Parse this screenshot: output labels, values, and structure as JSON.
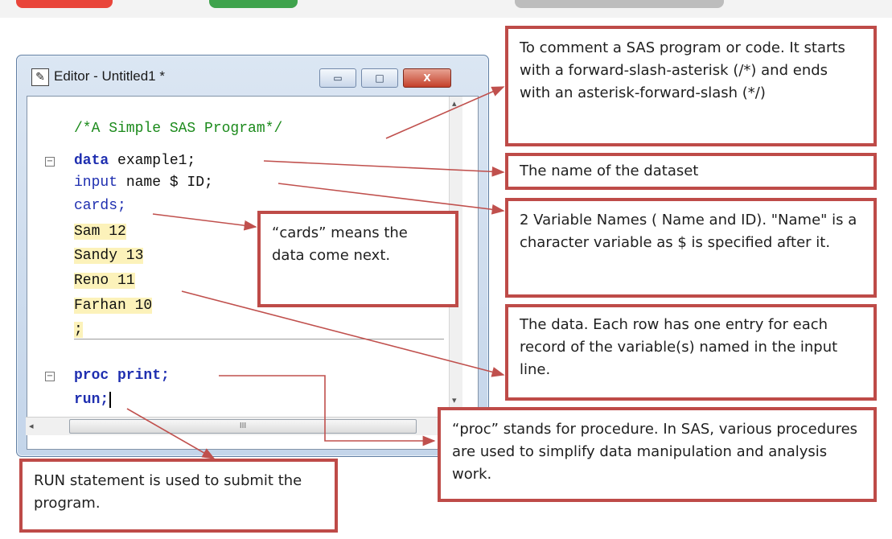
{
  "window": {
    "title": "Editor - Untitled1 *",
    "controls": {
      "minimize": "▭",
      "maximize": "□",
      "close": "X"
    },
    "hscroll_thumb": "III"
  },
  "code": {
    "comment": "/*A Simple SAS Program*/",
    "data_kw": "data",
    "data_rest": " example1;",
    "input_kw": "input",
    "input_rest": " name $ ID;",
    "cards_kw": "cards;",
    "rows": [
      "Sam 12",
      "Sandy 13",
      "Reno 11",
      "Farhan 10"
    ],
    "semicolon": ";",
    "proc_kw": "proc print;",
    "run_kw": "run;"
  },
  "notes": {
    "comment": "To comment a SAS program or code. It starts with a forward-slash-asterisk (/*) and ends with an asterisk-forward-slash (*/)",
    "dataset": "The name of the dataset",
    "variables": "2 Variable Names ( Name and ID). \"Name\" is a character variable as $ is specified after it.",
    "cards": "“cards” means the data come next.",
    "data": "The data. Each row has one entry for each record of the variable(s) named in the input line.",
    "proc": "“proc” stands for procedure. In SAS, various procedures are used to simplify data manipulation and analysis work.",
    "run": "RUN statement is used to submit the program."
  },
  "colors": {
    "annotation_border": "#be4b48",
    "arrow": "#c0504d",
    "keyword": "#1f2fb0",
    "comment": "#1b8a1b",
    "data_highlight": "#fcf2ba"
  }
}
